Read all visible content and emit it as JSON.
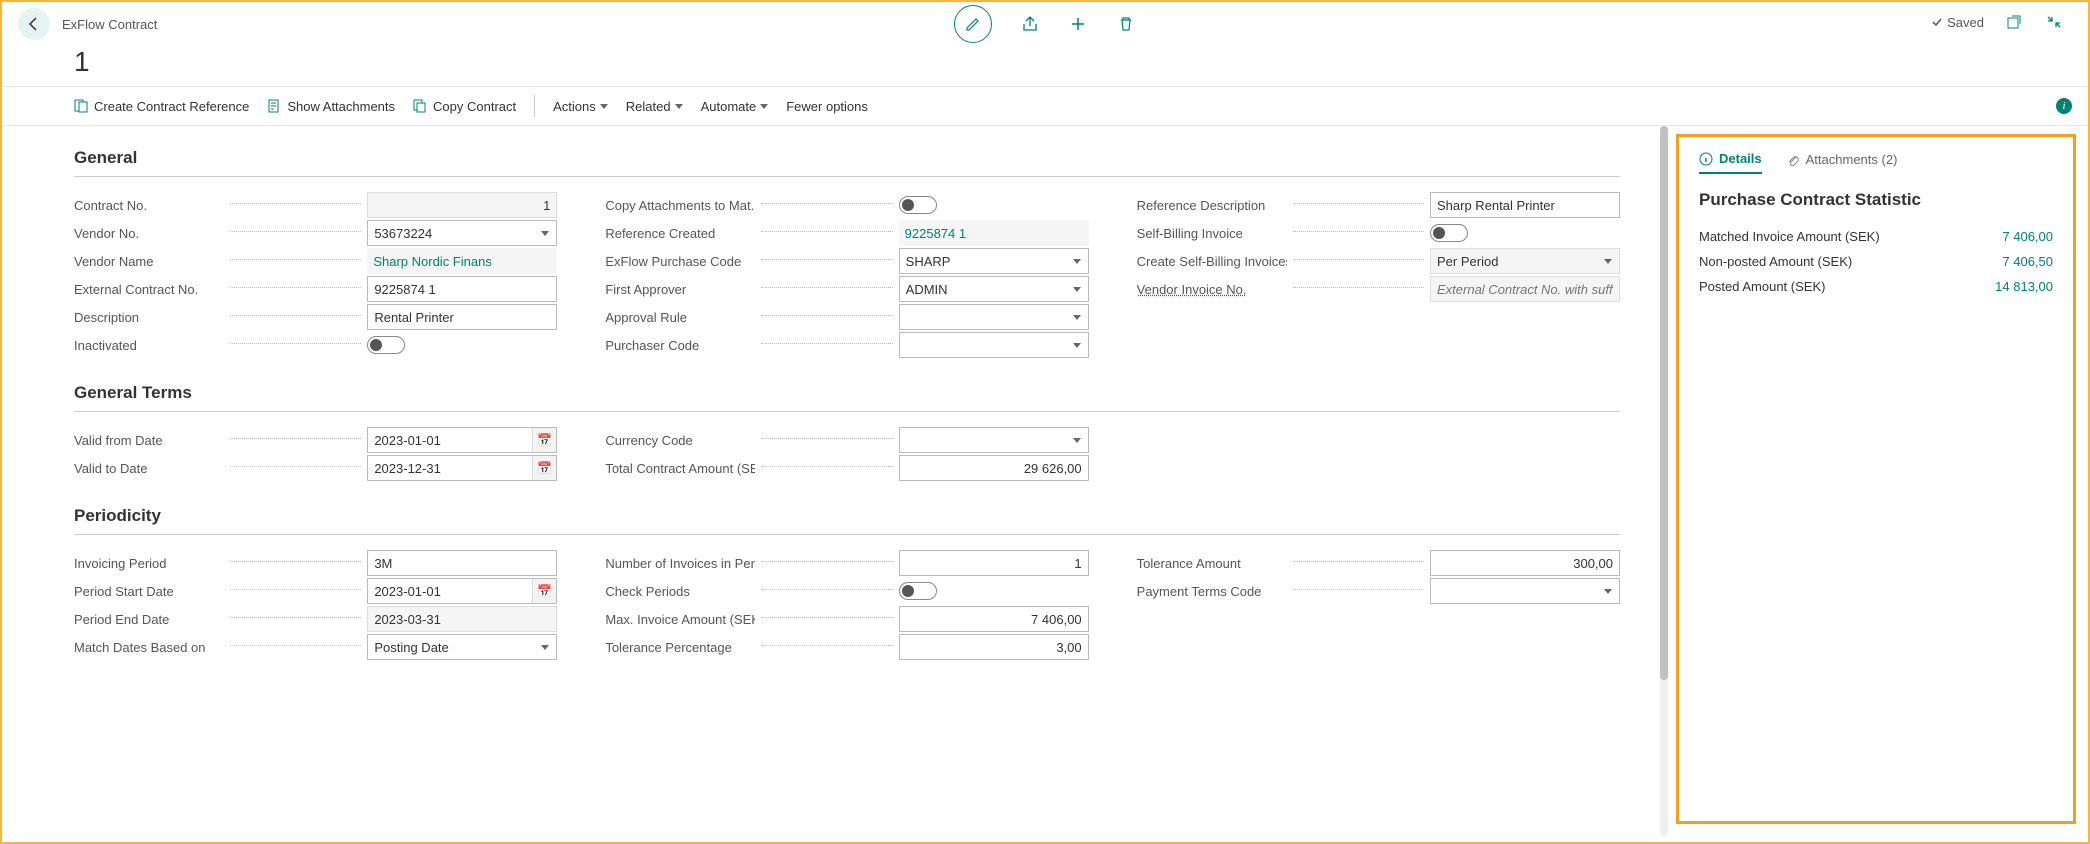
{
  "header": {
    "title": "ExFlow Contract",
    "record_id": "1",
    "saved_label": "Saved"
  },
  "actions": {
    "create_ref": "Create Contract Reference",
    "show_attach": "Show Attachments",
    "copy_contract": "Copy Contract",
    "actions_menu": "Actions",
    "related_menu": "Related",
    "automate_menu": "Automate",
    "fewer": "Fewer options"
  },
  "sections": {
    "general": "General",
    "terms": "General Terms",
    "periodicity": "Periodicity"
  },
  "general": {
    "contract_no_label": "Contract No.",
    "contract_no": "1",
    "vendor_no_label": "Vendor No.",
    "vendor_no": "53673224",
    "vendor_name_label": "Vendor Name",
    "vendor_name": "Sharp Nordic Finans",
    "ext_contract_label": "External Contract No.",
    "ext_contract": "9225874 1",
    "description_label": "Description",
    "description": "Rental Printer",
    "inactivated_label": "Inactivated",
    "copy_attach_label": "Copy Attachments to Mat...",
    "ref_created_label": "Reference Created",
    "ref_created": "9225874 1",
    "purchase_code_label": "ExFlow Purchase Code",
    "purchase_code": "SHARP",
    "first_approver_label": "First Approver",
    "first_approver": "ADMIN",
    "approval_rule_label": "Approval Rule",
    "approval_rule": "",
    "purchaser_label": "Purchaser Code",
    "purchaser": "",
    "ref_desc_label": "Reference Description",
    "ref_desc": "Sharp Rental Printer",
    "self_bill_label": "Self-Billing Invoice",
    "create_self_bill_label": "Create Self-Billing Invoices",
    "create_self_bill": "Per Period",
    "vendor_invoice_label": "Vendor Invoice No.",
    "vendor_invoice_placeholder": "External Contract No. with suffix Period S"
  },
  "terms": {
    "valid_from_label": "Valid from Date",
    "valid_from": "2023-01-01",
    "valid_to_label": "Valid to Date",
    "valid_to": "2023-12-31",
    "currency_label": "Currency Code",
    "currency": "",
    "total_label": "Total Contract Amount (SE...",
    "total": "29 626,00"
  },
  "periodicity": {
    "period_label": "Invoicing Period",
    "period": "3M",
    "start_label": "Period Start Date",
    "start": "2023-01-01",
    "end_label": "Period End Date",
    "end": "2023-03-31",
    "match_label": "Match Dates Based on",
    "match": "Posting Date",
    "num_inv_label": "Number of Invoices in Per...",
    "num_inv": "1",
    "check_label": "Check Periods",
    "max_inv_label": "Max. Invoice Amount (SEK)",
    "max_inv": "7 406,00",
    "tol_pct_label": "Tolerance Percentage",
    "tol_pct": "3,00",
    "tol_amt_label": "Tolerance Amount",
    "tol_amt": "300,00",
    "pay_terms_label": "Payment Terms Code",
    "pay_terms": ""
  },
  "side": {
    "details_tab": "Details",
    "attach_tab": "Attachments (2)",
    "panel_title": "Purchase Contract Statistic",
    "rows": [
      {
        "label": "Matched Invoice Amount (SEK)",
        "value": "7 406,00"
      },
      {
        "label": "Non-posted Amount (SEK)",
        "value": "7 406,50"
      },
      {
        "label": "Posted Amount (SEK)",
        "value": "14 813,00"
      }
    ]
  }
}
